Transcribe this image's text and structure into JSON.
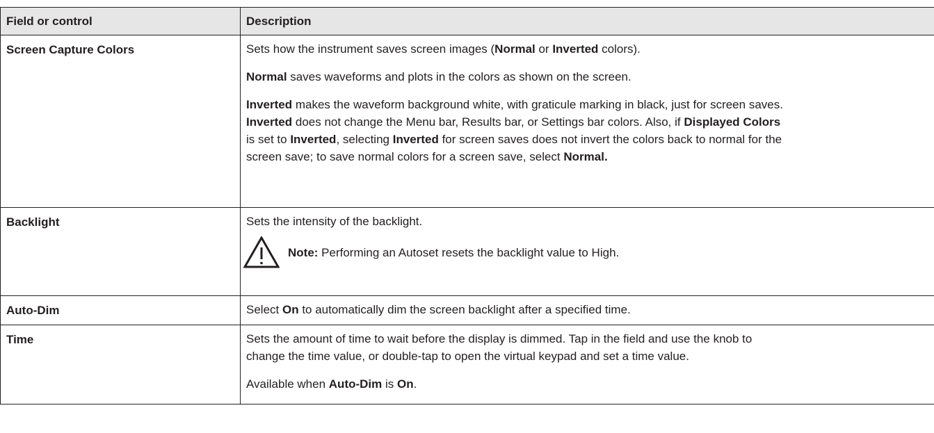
{
  "table": {
    "headers": [
      "Field or control",
      "Description"
    ],
    "rows": [
      {
        "field": "Screen Capture Colors",
        "p1": [
          "Sets how the instrument saves screen images (",
          "Normal",
          " or ",
          "Inverted",
          " colors)."
        ],
        "p2": [
          "Normal",
          " saves waveforms and plots in the colors as shown on the screen."
        ],
        "p3_lines": [
          [
            "Inverted",
            " makes the waveform background white, with graticule marking in black, just for screen saves."
          ],
          [
            "Inverted",
            " does not change the Menu bar, Results bar, or Settings bar colors. Also, if ",
            "Displayed Colors"
          ],
          [
            "is set to ",
            "Inverted",
            ", selecting ",
            "Inverted",
            " for screen saves does not invert the colors back to normal for the"
          ],
          [
            "screen save; to save normal colors for a screen save, select ",
            "Normal."
          ]
        ]
      },
      {
        "field": "Backlight",
        "p1": "Sets the intensity of the backlight.",
        "note": [
          "Note:",
          " Performing an Autoset resets the backlight value to High."
        ],
        "note_icon": "warning-triangle-icon"
      },
      {
        "field": "Auto-Dim",
        "p1": [
          "Select ",
          "On",
          " to automatically dim the screen backlight after a specified time."
        ]
      },
      {
        "field": "Time",
        "p1_lines": [
          "Sets the amount of time to wait before the display is dimmed. Tap in the field and use the knob to",
          "change the time value, or double-tap to open the virtual keypad and set a time value."
        ],
        "p2": [
          "Available when ",
          "Auto-Dim",
          " is ",
          "On",
          "."
        ]
      }
    ]
  }
}
